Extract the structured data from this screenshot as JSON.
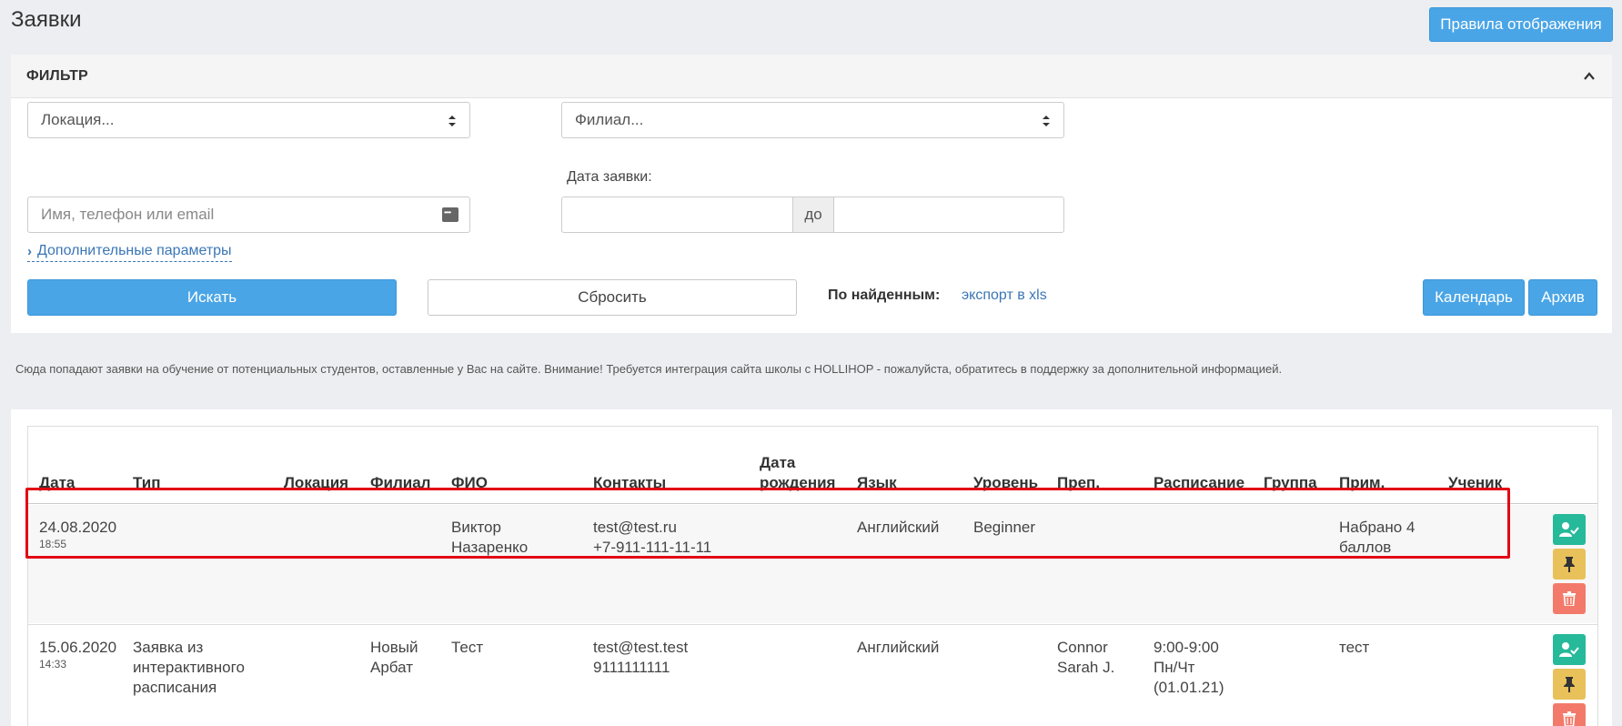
{
  "page": {
    "title": "Заявки",
    "rules_button": "Правила отображения"
  },
  "filter": {
    "title": "ФИЛЬТР",
    "location_select": "Локация...",
    "branch_select": "Филиал...",
    "search_placeholder": "Имя, телефон или email",
    "date_label": "Дата заявки:",
    "date_to_label": "до",
    "more_params": "Дополнительные параметры",
    "search_button": "Искать",
    "reset_button": "Сбросить",
    "found_label": "По найденным:",
    "export_link": "экспорт в xls",
    "calendar_button": "Календарь",
    "archive_button": "Архив"
  },
  "notice": "Сюда попадают заявки на обучение от потенциальных студентов, оставленные у Вас на сайте. Внимание! Требуется интеграция сайта школы с HOLLIHOP - пожалуйста, обратитесь в поддержку за дополнительной информацией.",
  "table": {
    "headers": {
      "date": "Дата",
      "type": "Тип",
      "location": "Локация",
      "branch": "Филиал",
      "fio": "ФИО",
      "contacts": "Контакты",
      "birth_line1": "Дата",
      "birth_line2": "рождения",
      "language": "Язык",
      "level": "Уровень",
      "teacher": "Преп.",
      "schedule": "Расписание",
      "group": "Группа",
      "note": "Прим.",
      "student": "Ученик"
    },
    "rows": [
      {
        "date": "24.08.2020",
        "time": "18:55",
        "type": "",
        "location": "",
        "branch": "",
        "fio_line1": "Виктор",
        "fio_line2": "Назаренко",
        "email": "test@test.ru",
        "phone": "+7-911-111-11-11",
        "language": "Английский",
        "level": "Beginner",
        "teacher_line1": "",
        "teacher_line2": "",
        "schedule_line1": "",
        "schedule_line2": "",
        "schedule_line3": "",
        "note_line1": "Набрано 4",
        "note_line2": "баллов"
      },
      {
        "date": "15.06.2020",
        "time": "14:33",
        "type_line1": "Заявка из",
        "type_line2": "интерактивного",
        "type_line3": "расписания",
        "location": "",
        "branch_line1": "Новый",
        "branch_line2": "Арбат",
        "fio_line1": "Тест",
        "fio_line2": "",
        "email": "test@test.test",
        "phone": "9111111111",
        "language": "Английский",
        "level": "",
        "teacher_line1": "Connor",
        "teacher_line2": "Sarah J.",
        "schedule_line1": "9:00-9:00",
        "schedule_line2": "Пн/Чт",
        "schedule_line3": "(01.01.21)",
        "note_line1": "тест",
        "note_line2": ""
      }
    ]
  },
  "colors": {
    "primary": "#4aa5e6",
    "highlight_border": "#e20613",
    "action_green": "#26b99a",
    "action_yellow": "#e8c15a",
    "action_red": "#f37a6a",
    "link": "#3a76b6"
  },
  "icons": [
    "chevron-up-icon",
    "select-arrows-icon",
    "keyboard-icon",
    "chevron-right-icon",
    "user-check-icon",
    "pin-icon",
    "trash-icon"
  ]
}
